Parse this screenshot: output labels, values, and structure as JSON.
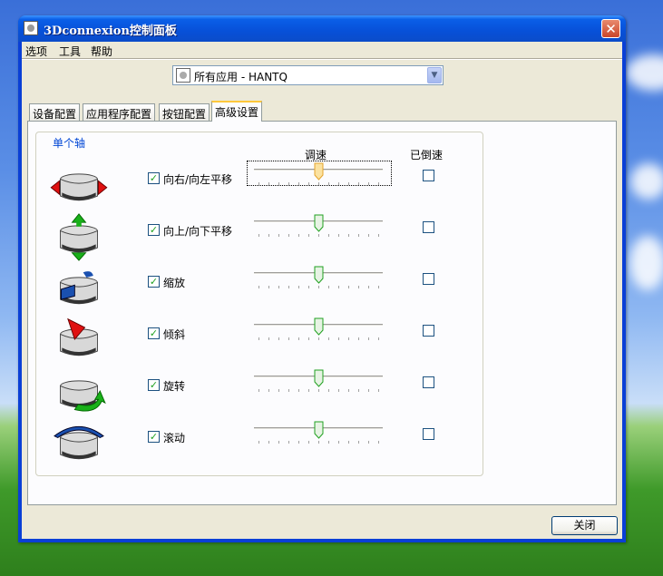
{
  "window": {
    "title": "3Dconnexion控制面板",
    "close_glyph": "✕"
  },
  "menu": [
    "选项",
    "工具",
    "帮助"
  ],
  "app_selector": {
    "value": "所有应用 - HANTQ",
    "icon": "app-icon"
  },
  "tabs": [
    {
      "label": "设备配置",
      "active": false
    },
    {
      "label": "应用程序配置",
      "active": false
    },
    {
      "label": "按钮配置",
      "active": false
    },
    {
      "label": "高级设置",
      "active": true
    }
  ],
  "group": {
    "title": "单个轴",
    "col_speed": "调速",
    "col_reverse": "已倒速"
  },
  "axes": [
    {
      "label": "向右/向左平移",
      "enabled": true,
      "speed_pct": 50,
      "reversed": false,
      "icon": "pan-right-left-icon",
      "focused": true
    },
    {
      "label": "向上/向下平移",
      "enabled": true,
      "speed_pct": 50,
      "reversed": false,
      "icon": "pan-up-down-icon",
      "focused": false
    },
    {
      "label": "缩放",
      "enabled": true,
      "speed_pct": 50,
      "reversed": false,
      "icon": "zoom-icon",
      "focused": false
    },
    {
      "label": "倾斜",
      "enabled": true,
      "speed_pct": 50,
      "reversed": false,
      "icon": "tilt-icon",
      "focused": false
    },
    {
      "label": "旋转",
      "enabled": true,
      "speed_pct": 50,
      "reversed": false,
      "icon": "spin-icon",
      "focused": false
    },
    {
      "label": "滚动",
      "enabled": true,
      "speed_pct": 50,
      "reversed": false,
      "icon": "roll-icon",
      "focused": false
    }
  ],
  "buttons": {
    "close": "关闭"
  },
  "colors": {
    "title_bar": "#0750d8",
    "group_title": "#0046d5",
    "check": "#21a121",
    "arrow_red": "#e01010",
    "arrow_green": "#19b019",
    "arrow_blue": "#1a50b0"
  }
}
